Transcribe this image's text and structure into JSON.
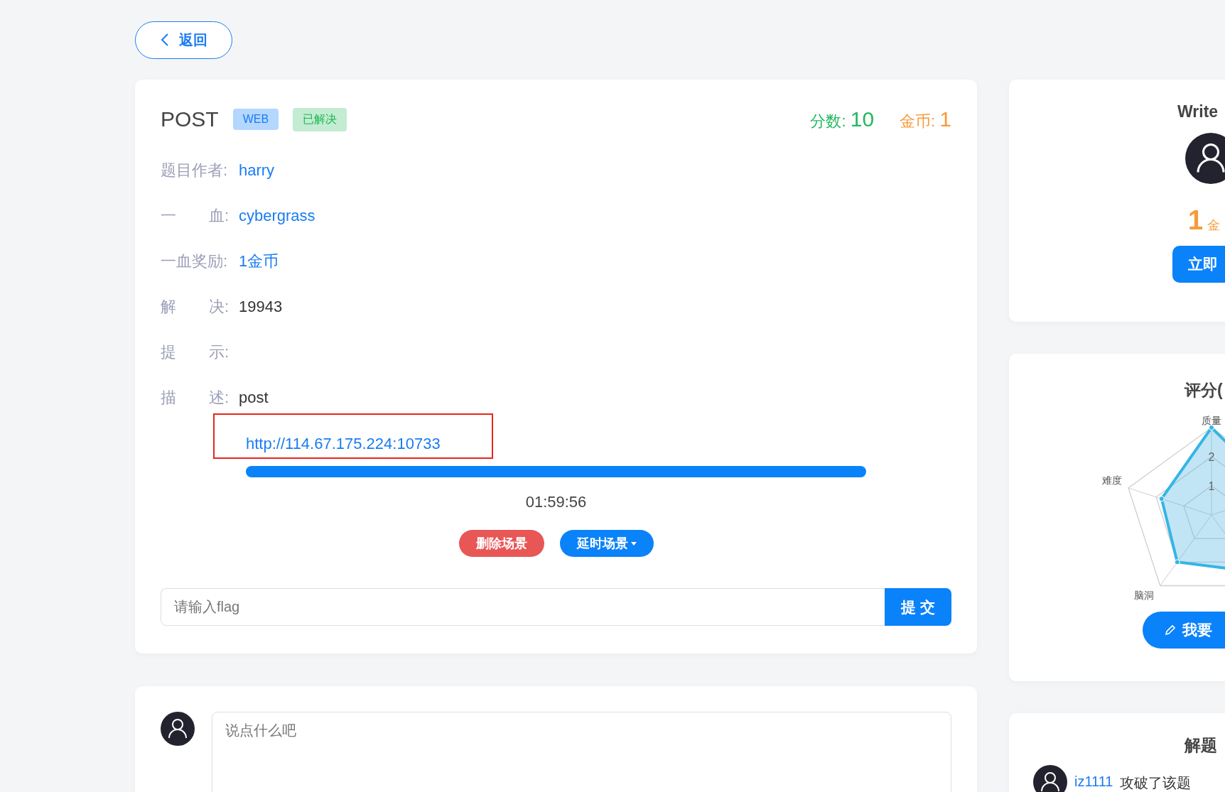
{
  "back_button": {
    "label": "返回"
  },
  "challenge": {
    "title": "POST",
    "tags": [
      {
        "label": "WEB",
        "kind": "category"
      },
      {
        "label": "已解决",
        "kind": "status"
      }
    ],
    "score": {
      "label": "分数:",
      "value": "10"
    },
    "coins": {
      "label": "金币:",
      "value": "1"
    },
    "fields": [
      {
        "label": [
          "题目作者:"
        ],
        "value": "harry",
        "kind": "link"
      },
      {
        "label": [
          "一",
          "血:"
        ],
        "value": "cybergrass",
        "kind": "link"
      },
      {
        "label": [
          "一血奖励:"
        ],
        "value": "1金币",
        "kind": "link"
      },
      {
        "label": [
          "解",
          "决:"
        ],
        "value": "19943",
        "kind": "text"
      },
      {
        "label": [
          "提",
          "示:"
        ]
      },
      {
        "label": [
          "描",
          "述:"
        ],
        "value": "post",
        "kind": "text"
      }
    ]
  },
  "scene": {
    "url": "http://114.67.175.224:10733",
    "level": 1,
    "timer": "01:59:56",
    "buttons": [
      {
        "label": "删除场景",
        "kind": "danger"
      },
      {
        "label": "延时场景",
        "kind": "dropdown"
      }
    ]
  },
  "flag": {
    "placeholder": "请输入flag",
    "submit": "提 交"
  },
  "comment": {
    "placeholder": "说点什么吧"
  },
  "sidebar": {
    "writeup": {
      "title": "Write",
      "coins": "1",
      "coin_unit": "金",
      "button": "立即"
    },
    "rating": {
      "title": "评分(",
      "axes": [
        "质量",
        "难度",
        "脑洞"
      ],
      "ticks": [
        "2",
        "1"
      ],
      "button": "我要"
    },
    "activity": {
      "title": "解题",
      "entries": [
        {
          "user": "iz1111",
          "text": "攻破了该题"
        }
      ]
    }
  }
}
